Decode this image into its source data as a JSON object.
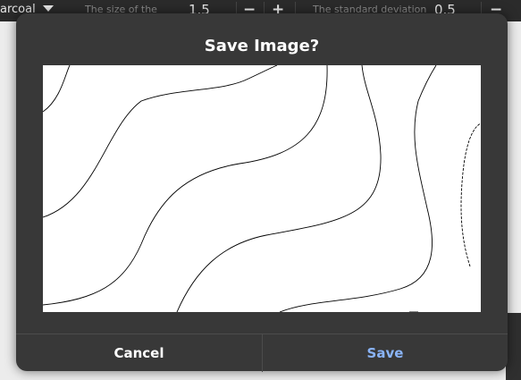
{
  "toolbar": {
    "mode_label": "arcoal",
    "param1_label": "The size of the",
    "param1_value": "1.5",
    "minus_label": "−",
    "plus_label": "+",
    "param2_label": "The standard deviation",
    "param2_value": "0.5",
    "minus2_label": "−"
  },
  "dialog": {
    "title": "Save Image?",
    "cancel_label": "Cancel",
    "save_label": "Save"
  },
  "colors": {
    "dialog_bg": "#383838",
    "accent": "#8ab4f8",
    "preview_bg": "#ffffff"
  }
}
